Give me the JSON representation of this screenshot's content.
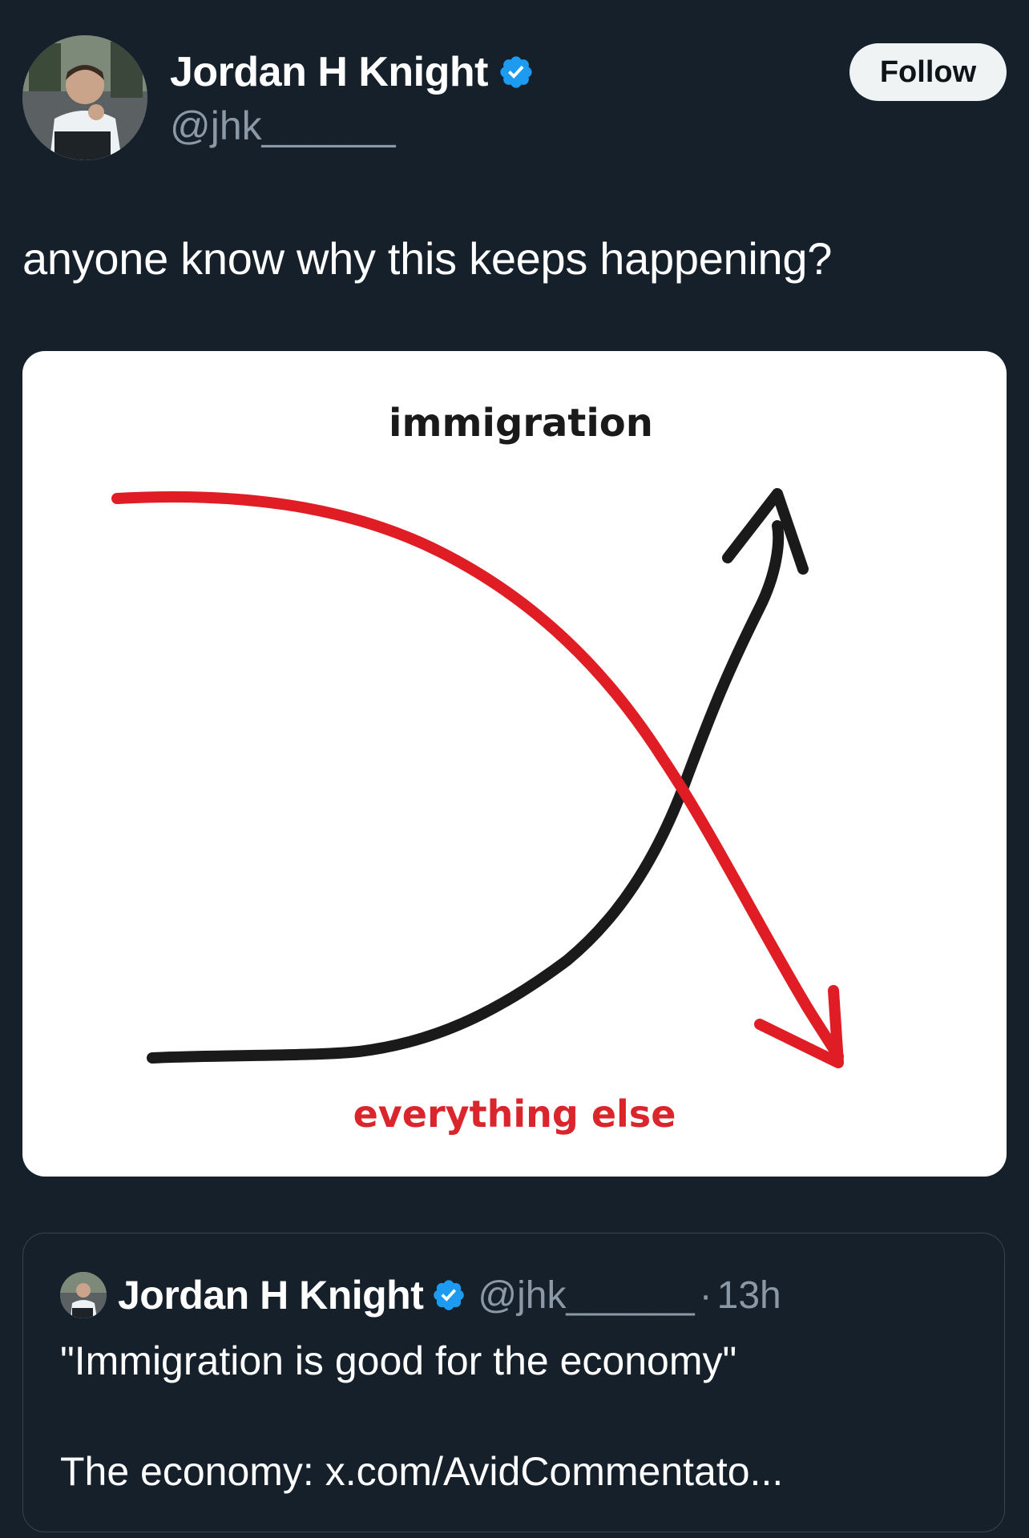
{
  "author": {
    "display_name": "Jordan H Knight",
    "handle": "@jhk______",
    "verified_icon": "verified-badge-icon",
    "avatar_icon": "profile-photo"
  },
  "follow": {
    "label": "Follow"
  },
  "tweet": {
    "text": "anyone know why this keeps happening?"
  },
  "image": {
    "top_label": "immigration",
    "bottom_label": "everything else",
    "colors": {
      "immigration": "#1a1a1a",
      "everything_else": "#e01d24"
    }
  },
  "quoted_tweet": {
    "display_name": "Jordan H Knight",
    "handle": "@jhk______",
    "separator": "·",
    "timestamp": "13h",
    "line1": "\"Immigration is good for the economy\"",
    "line2": "The economy: x.com/AvidCommentato..."
  },
  "colors": {
    "background": "#15202b",
    "secondary_text": "#8b98a5",
    "verified_blue": "#1d9bf0",
    "border": "#38444d"
  }
}
